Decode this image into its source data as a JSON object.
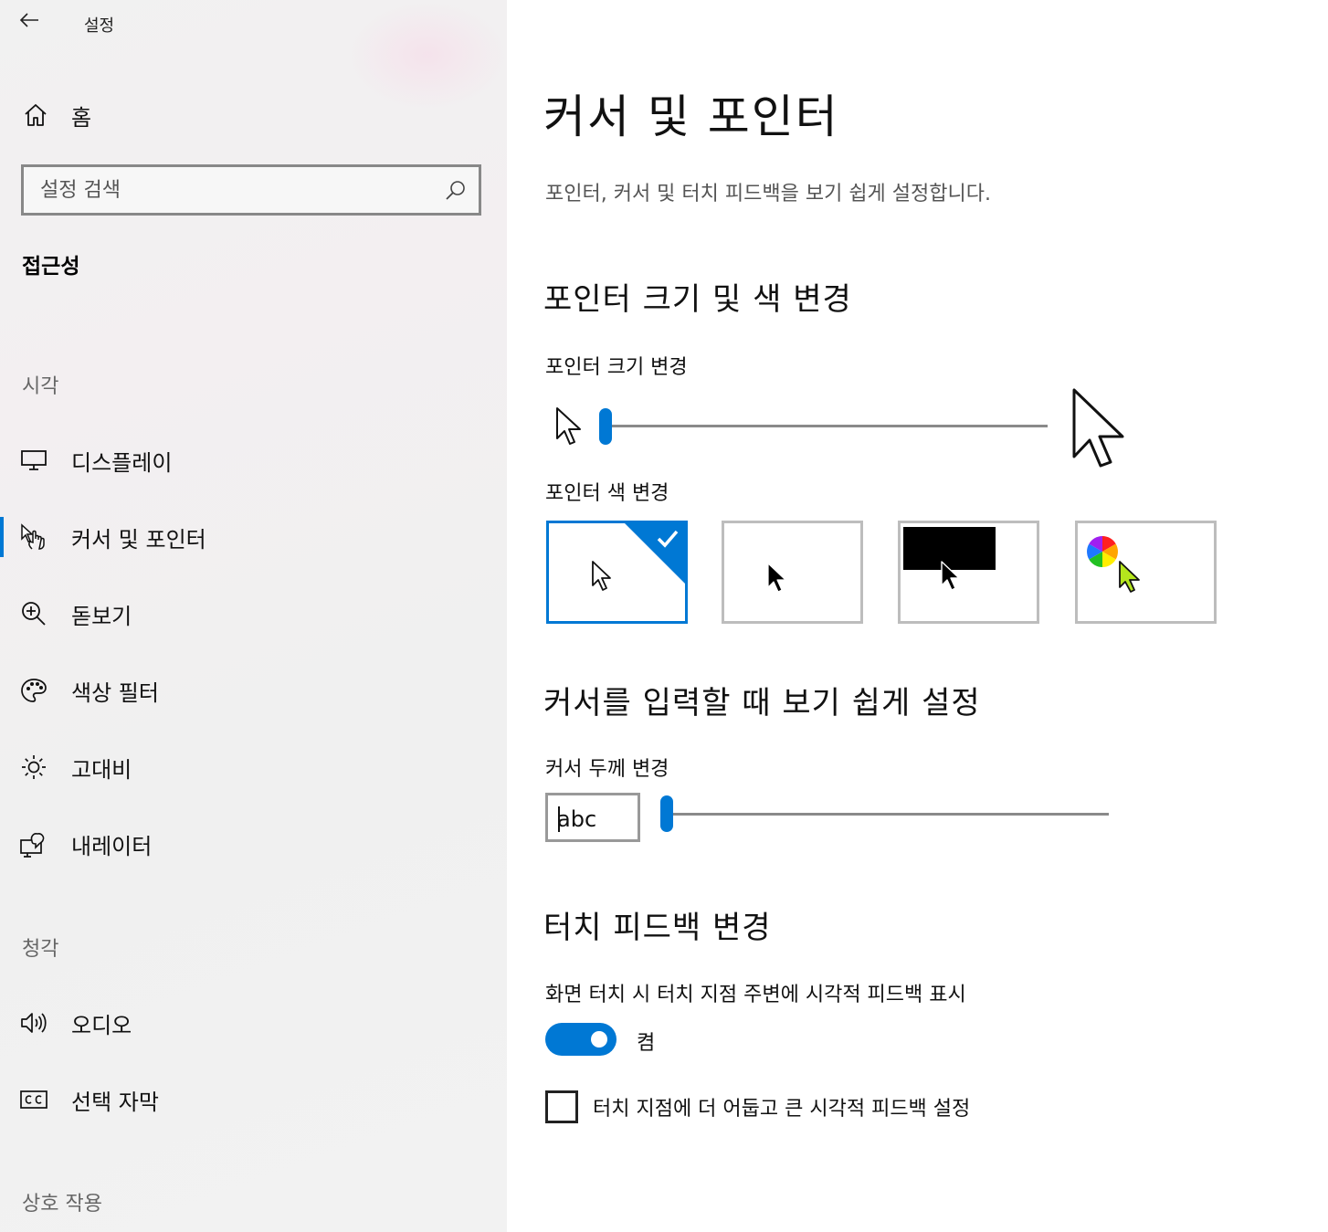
{
  "app": {
    "title": "설정"
  },
  "sidebar": {
    "home_label": "홈",
    "search_placeholder": "설정 검색",
    "section_title": "접근성",
    "groups": {
      "vision": "시각",
      "hearing": "청각",
      "interaction": "상호 작용"
    },
    "items": [
      {
        "label": "디스플레이",
        "icon": "monitor-icon"
      },
      {
        "label": "커서 및 포인터",
        "icon": "cursor-hand-icon",
        "active": true
      },
      {
        "label": "돋보기",
        "icon": "magnifier-icon"
      },
      {
        "label": "색상 필터",
        "icon": "palette-icon"
      },
      {
        "label": "고대비",
        "icon": "brightness-icon"
      },
      {
        "label": "내레이터",
        "icon": "narrator-icon"
      },
      {
        "label": "오디오",
        "icon": "speaker-icon"
      },
      {
        "label": "선택 자막",
        "icon": "closed-caption-icon"
      }
    ]
  },
  "main": {
    "title": "커서 및 포인터",
    "description": "포인터, 커서 및 터치 피드백을 보기 쉽게 설정합니다.",
    "pointer_section": {
      "heading": "포인터 크기 및 색 변경",
      "size_label": "포인터 크기 변경",
      "size_value": 0.0,
      "color_label": "포인터 색 변경",
      "color_options": [
        "white",
        "black",
        "inverted",
        "custom"
      ],
      "selected_color": "white"
    },
    "cursor_section": {
      "heading": "커서를 입력할 때 보기 쉽게 설정",
      "thickness_label": "커서 두께 변경",
      "preview_text": "abc",
      "thickness_value": 0.0
    },
    "touch_section": {
      "heading": "터치 피드백 변경",
      "show_feedback_label": "화면 터치 시 터치 지점 주변에 시각적 피드백 표시",
      "toggle_state_label": "켬",
      "toggle_on": true,
      "darker_feedback_label": "터치 지점에 더 어둡고 큰 시각적 피드백 설정",
      "darker_feedback_checked": false
    }
  },
  "colors": {
    "accent": "#0078d4",
    "custom_pointer": "#b5e61d"
  }
}
